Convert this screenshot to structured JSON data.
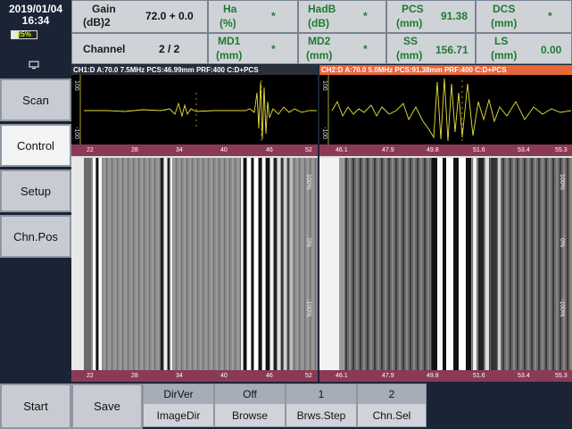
{
  "status": {
    "date": "2019/01/04",
    "time": "16:34",
    "battery": "25%"
  },
  "params": {
    "gain_label": "Gain",
    "gain_unit": "(dB)2",
    "gain_value": "72.0 + 0.0",
    "channel_label": "Channel",
    "channel_value": "2 / 2",
    "ha_label": "Ha",
    "ha_unit": "(%)",
    "ha_value": "*",
    "hadb_label": "HadB",
    "hadb_unit": "(dB)",
    "hadb_value": "*",
    "pcs_label": "PCS",
    "pcs_unit": "(mm)",
    "pcs_value": "91.38",
    "dcs_label": "DCS",
    "dcs_unit": "(mm)",
    "dcs_value": "*",
    "md1_label": "MD1",
    "md1_unit": "(mm)",
    "md1_value": "*",
    "md2_label": "MD2",
    "md2_unit": "(mm)",
    "md2_value": "*",
    "ss_label": "SS",
    "ss_unit": "(mm)",
    "ss_value": "156.71",
    "ls_label": "LS",
    "ls_unit": "(mm)",
    "ls_value": "0.00"
  },
  "menu": {
    "scan": "Scan",
    "control": "Control",
    "setup": "Setup",
    "chnpos": "Chn.Pos"
  },
  "channels": {
    "ch1_header": "CH1:D  A:70.0  7.5MHz  PCS:46.99mm  PRF:400   C:D+PCS",
    "ch2_header": "CH2:D  A:70.0  5.0MHz  PCS:91.38mm  PRF:400   C:D+PCS",
    "ch1_ticks": [
      "22",
      "28",
      "34",
      "40",
      "46",
      "52"
    ],
    "ch2_ticks": [
      "46.1",
      "47.9",
      "49.8",
      "51.6",
      "53.4",
      "55.3"
    ],
    "ascan_top": "100",
    "ascan_bottom": "-100",
    "bscan_labels": [
      "100%",
      "0%",
      "-100%"
    ]
  },
  "bottom": {
    "start": "Start",
    "save": "Save",
    "imagedir_value": "DirVer",
    "imagedir_label": "ImageDir",
    "browse_value": "Off",
    "browse_label": "Browse",
    "brwsstep_value": "1",
    "brwsstep_label": "Brws.Step",
    "chnsel_value": "2",
    "chnsel_label": "Chn.Sel"
  },
  "colors": {
    "accent_orange": "#e8663c",
    "value_green": "#1f7a2e",
    "ruler_magenta": "#8a3a55",
    "trace_yellow": "#e8e23a"
  }
}
